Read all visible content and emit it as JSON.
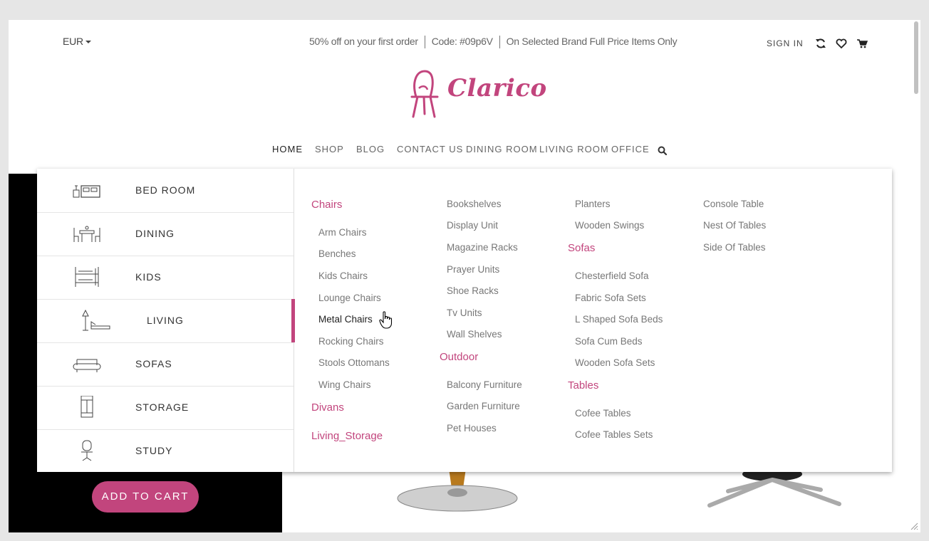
{
  "topbar": {
    "currency": "EUR",
    "promo_1": "50% off on your first order",
    "promo_2": "Code: #09p6V",
    "promo_3": "On Selected Brand Full Price Items Only",
    "sign_in": "SIGN IN"
  },
  "logo": {
    "text": "Clarico"
  },
  "nav": [
    "HOME",
    "SHOP",
    "BLOG",
    "CONTACT US",
    "DINING ROOM",
    "LIVING ROOM",
    "OFFICE"
  ],
  "categories": [
    "BED ROOM",
    "DINING",
    "KIDS",
    "LIVING",
    "SOFAS",
    "STORAGE",
    "STUDY"
  ],
  "active_category": "LIVING",
  "menu": {
    "chairs": {
      "heading": "Chairs",
      "items": [
        "Arm Chairs",
        "Benches",
        "Kids Chairs",
        "Lounge Chairs",
        "Metal Chairs",
        "Rocking Chairs",
        "Stools Ottomans",
        "Wing Chairs"
      ]
    },
    "divans": {
      "heading": "Divans"
    },
    "living_storage": {
      "heading": "Living_Storage"
    },
    "storage_items": [
      "Bookshelves",
      "Display Unit",
      "Magazine Racks",
      "Prayer Units",
      "Shoe Racks",
      "Tv Units",
      "Wall Shelves"
    ],
    "outdoor": {
      "heading": "Outdoor",
      "items": [
        "Balcony Furniture",
        "Garden Furniture",
        "Pet Houses"
      ]
    },
    "outdoor_more": [
      "Planters",
      "Wooden Swings"
    ],
    "sofas": {
      "heading": "Sofas",
      "items": [
        "Chesterfield Sofa",
        "Fabric Sofa Sets",
        "L Shaped Sofa Beds",
        "Sofa Cum Beds",
        "Wooden Sofa Sets"
      ]
    },
    "tables": {
      "heading": "Tables",
      "items": [
        "Cofee Tables",
        "Cofee Tables Sets"
      ]
    },
    "tables_more": [
      "Console Table",
      "Nest Of Tables",
      "Side Of Tables"
    ]
  },
  "hero": {
    "add_to_cart": "ADD TO CART"
  },
  "colors": {
    "accent": "#c2457d"
  }
}
